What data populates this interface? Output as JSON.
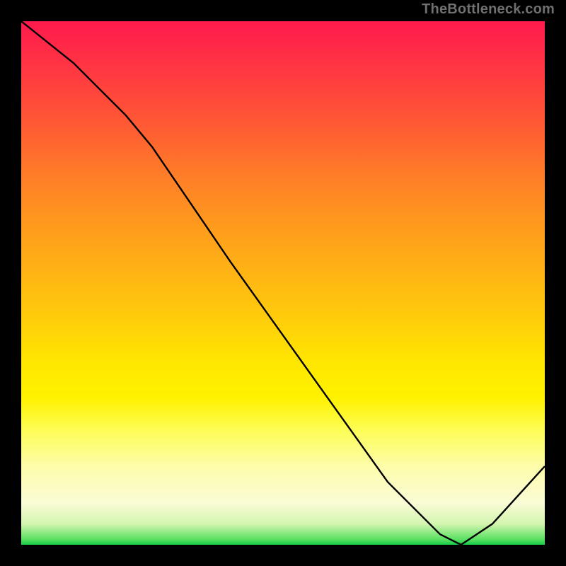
{
  "attribution": "TheBottleneck.com",
  "marker_text": "",
  "chart_data": {
    "type": "line",
    "title": "",
    "xlabel": "",
    "ylabel": "",
    "xlim": [
      0,
      100
    ],
    "ylim": [
      0,
      100
    ],
    "series": [
      {
        "name": "curve",
        "x": [
          0,
          10,
          20,
          25,
          40,
          55,
          70,
          80,
          84,
          90,
          100
        ],
        "y": [
          100,
          92,
          82,
          76,
          54,
          33,
          12,
          2,
          0,
          4,
          15
        ]
      }
    ],
    "annotations": [
      {
        "name": "min-marker",
        "x": 80,
        "y": 0
      }
    ],
    "background_gradient": {
      "direction": "vertical",
      "stops": [
        {
          "pos": 0.0,
          "color": "#ff1a4d"
        },
        {
          "pos": 0.3,
          "color": "#ff7f27"
        },
        {
          "pos": 0.65,
          "color": "#ffe600"
        },
        {
          "pos": 0.92,
          "color": "#fafcd6"
        },
        {
          "pos": 1.0,
          "color": "#17c94b"
        }
      ]
    }
  }
}
